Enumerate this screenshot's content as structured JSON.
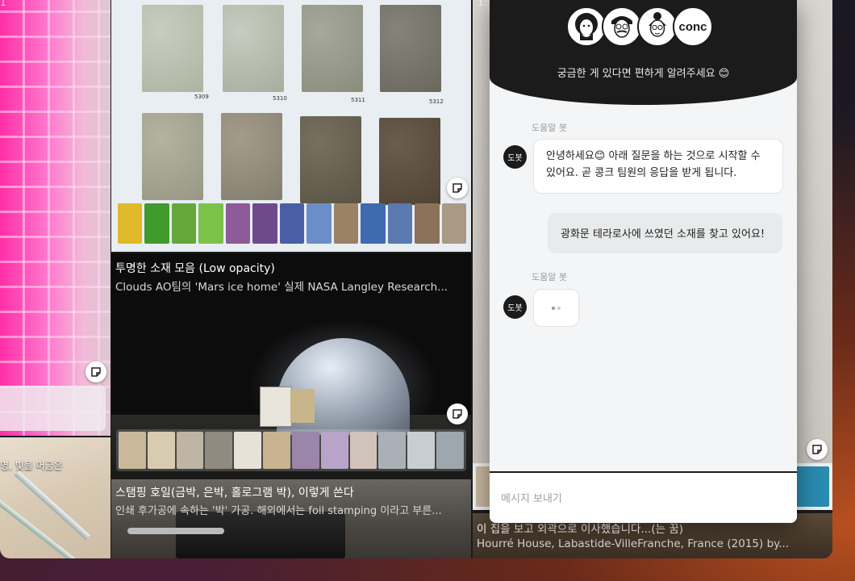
{
  "column1": {
    "top_caption": "1",
    "bottom_caption": "명, 빛을 머금은"
  },
  "column2": {
    "swatches": [
      {
        "code": "5309"
      },
      {
        "code": "5310"
      },
      {
        "code": "5311"
      },
      {
        "code": "5312"
      }
    ],
    "pin1": {
      "title": "투명한 소재 모음 (Low opacity)",
      "description": "Clouds AO팀의 'Mars ice home' 실제 NASA Langley Research..."
    },
    "pin2": {
      "title": "스탬핑 호일(금박, 은박, 홀로그램 박), 이렇게 쓴다",
      "description": "인쇄 후가공에 속하는 '박' 가공. 해외에서는 foil stamping 이라고 부른..."
    }
  },
  "column3": {
    "top_caption": "1.",
    "pin": {
      "title": "이 집을 보고 외곽으로 이사했습니다...(는 꿈)",
      "description": "Hourré House, Labastide-VilleFranche, France (2015) by..."
    }
  },
  "chat": {
    "avatar_text": "conc",
    "subtitle": "궁금한 게 있다면 편하게 알려주세요 😊",
    "bot_label": "도움말 봇",
    "bot_avatar_text": "도봇",
    "messages": [
      {
        "from": "bot",
        "text_line1": "안녕하세요😊 아래 질문을 하는 것으로 시작할 수",
        "text_line2": "있어요. 곧 콩크 팀원의 응답을 받게 됩니다."
      },
      {
        "from": "user",
        "text": "광화문 테라로사에 쓰였던 소재를 찾고 있어요!"
      }
    ],
    "input_placeholder": "메시지 보내기"
  }
}
